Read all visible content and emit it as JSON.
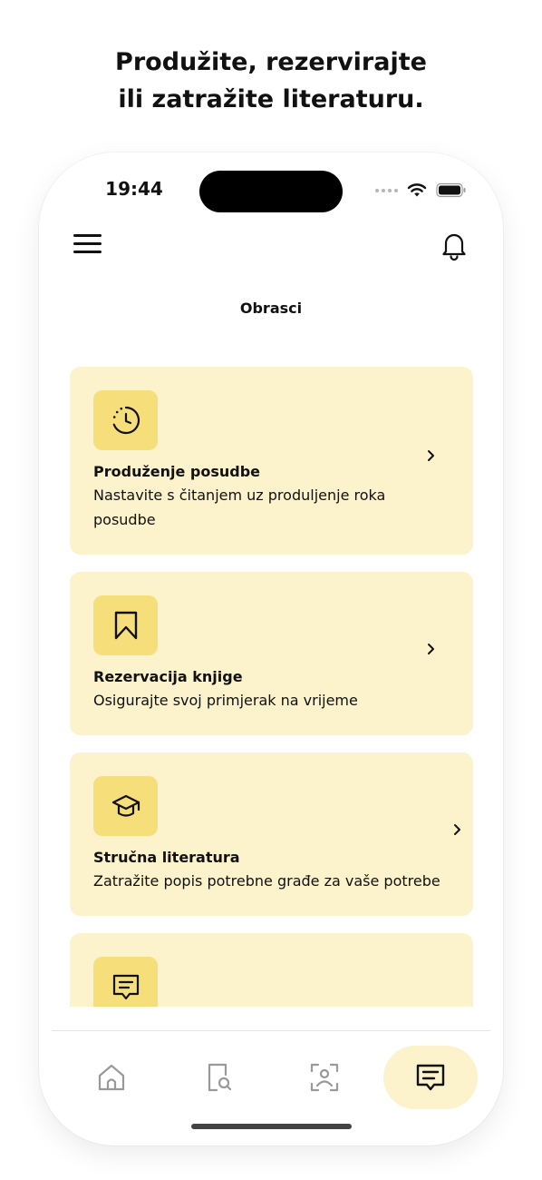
{
  "headline": {
    "line1": "Produžite, rezervirajte",
    "line2": "ili zatražite literaturu."
  },
  "status_bar": {
    "time": "19:44",
    "icons": [
      "signal-dots-icon",
      "wifi-icon",
      "battery-icon"
    ]
  },
  "app_header": {
    "title": "Obrasci",
    "menu_icon": "hamburger-menu-icon",
    "notification_icon": "bell-icon"
  },
  "cards": [
    {
      "icon": "clock-icon",
      "title": "Produženje posudbe",
      "description": "Nastavite s čitanjem uz produljenje roka posudbe"
    },
    {
      "icon": "bookmark-icon",
      "title": "Rezervacija knjige",
      "description": "Osigurajte svoj primjerak na vrijeme"
    },
    {
      "icon": "graduation-cap-icon",
      "title": "Stručna literatura",
      "description": "Zatražite popis potrebne građe za vaše potrebe"
    },
    {
      "icon": "message-icon",
      "title": "",
      "description": ""
    }
  ],
  "bottom_tabs": [
    {
      "icon": "home-icon",
      "active": false
    },
    {
      "icon": "document-search-icon",
      "active": false
    },
    {
      "icon": "scan-person-icon",
      "active": false
    },
    {
      "icon": "forms-message-icon",
      "active": true
    }
  ],
  "colors": {
    "card_background": "#fcf2cb",
    "icon_tile": "#f6df7b",
    "active_tab": "#fcf2cb",
    "text": "#111111"
  }
}
